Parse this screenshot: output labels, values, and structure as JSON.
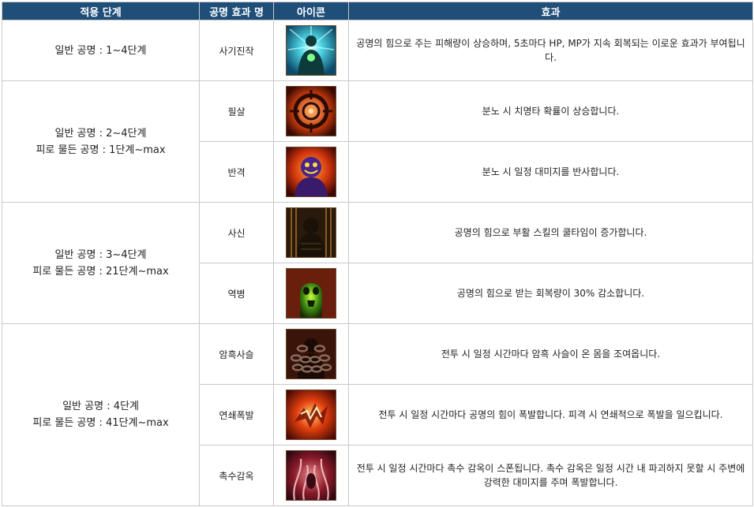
{
  "headers": {
    "stage": "적용 단계",
    "name": "공명 효과 명",
    "icon": "아이콘",
    "effect": "효과"
  },
  "groups": [
    {
      "stage_lines": [
        "일반 공명 : 1~4단계"
      ],
      "rows": [
        {
          "name": "사기진작",
          "icon": "morale-boost-icon",
          "effect": "공명의 힘으로 주는 피해량이 상승하며, 5초마다 HP, MP가 지속 회복되는 이로운 효과가 부여됩니다."
        }
      ]
    },
    {
      "stage_lines": [
        "일반 공명 : 2~4단계",
        "피로 물든 공명 : 1단계~max"
      ],
      "rows": [
        {
          "name": "필살",
          "icon": "crosshair-icon",
          "effect": "분노 시 치명타 확률이 상승합니다."
        },
        {
          "name": "반격",
          "icon": "counter-demon-icon",
          "effect": "분노 시 일정 대미지를 반사합니다."
        }
      ]
    },
    {
      "stage_lines": [
        "일반 공명 : 3~4단계",
        "피로 물든 공명 : 21단계~max"
      ],
      "rows": [
        {
          "name": "사신",
          "icon": "reaper-icon",
          "effect": "공명의 힘으로 부활 스킬의 쿨타임이 증가합니다."
        },
        {
          "name": "역병",
          "icon": "plague-skull-icon",
          "effect": "공명의 힘으로 받는 회복량이 30% 감소합니다."
        }
      ]
    },
    {
      "stage_lines": [
        "일반 공명 : 4단계",
        "피로 물든 공명 : 41단계~max"
      ],
      "rows": [
        {
          "name": "암흑사슬",
          "icon": "dark-chain-icon",
          "effect": "전투 시 일정 시간마다 암흑 사슬이 온 몸을 조여옵니다."
        },
        {
          "name": "연쇄폭발",
          "icon": "chain-explosion-icon",
          "effect": "전투 시 일정 시간마다 공명의 힘이 폭발합니다. 피격 시 연쇄적으로 폭발을 일으킵니다."
        },
        {
          "name": "촉수감옥",
          "icon": "tentacle-prison-icon",
          "effect": "전투 시 일정 시간마다 촉수 감옥이 스폰됩니다. 촉수 감옥은 일정 시간 내 파괴하지 못할 시 주변에 강력한 대미지를 주며 폭발합니다."
        }
      ]
    }
  ]
}
